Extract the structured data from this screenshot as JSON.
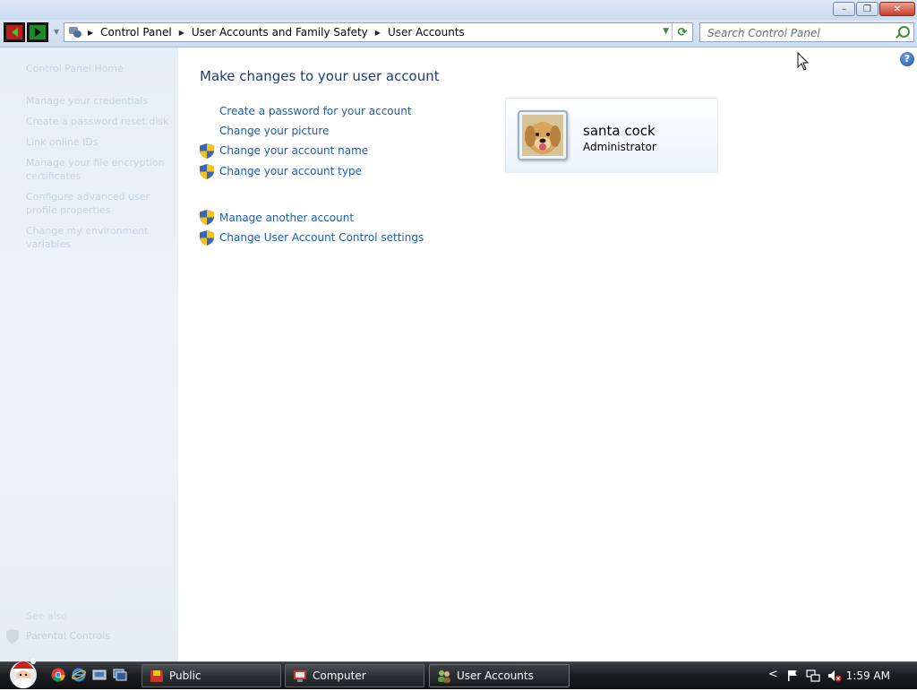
{
  "window": {
    "controls": {
      "minimize": "–",
      "maximize": "❐",
      "close": "✕"
    }
  },
  "nav": {
    "breadcrumbs": [
      "Control Panel",
      "User Accounts and Family Safety",
      "User Accounts"
    ],
    "search_placeholder": "Search Control Panel"
  },
  "left_pane": {
    "tasks": [
      "Control Panel Home",
      "Manage your credentials",
      "Create a password reset disk",
      "Link online IDs",
      "Manage your file encryption certificates",
      "Configure advanced user profile properties",
      "Change my environment variables"
    ],
    "see_also_heading": "See also",
    "see_also_items": [
      "Parental Controls"
    ]
  },
  "main": {
    "heading": "Make changes to your user account",
    "links_group1": [
      {
        "label": "Create a password for your account",
        "shield": false
      },
      {
        "label": "Change your picture",
        "shield": false
      },
      {
        "label": "Change your account name",
        "shield": true
      },
      {
        "label": "Change your account type",
        "shield": true
      }
    ],
    "links_group2": [
      {
        "label": "Manage another account",
        "shield": true
      },
      {
        "label": "Change User Account Control settings",
        "shield": true
      }
    ],
    "user": {
      "name": "santa cock",
      "role": "Administrator",
      "picture": "dog-avatar"
    },
    "help_glyph": "?"
  },
  "taskbar": {
    "buttons": [
      {
        "label": "Public",
        "icon": "folder-icon",
        "active": false
      },
      {
        "label": "Computer",
        "icon": "computer-icon",
        "active": false
      },
      {
        "label": "User Accounts",
        "icon": "users-icon",
        "active": true
      }
    ],
    "quick_launch": [
      "chrome-icon",
      "internet-explorer-icon",
      "show-desktop-icon",
      "switch-windows-icon"
    ],
    "tray_expand": "<",
    "clock": "1:59 AM"
  },
  "colors": {
    "link": "#1a5eb0",
    "heading": "#1e3a79",
    "nav_back": "#b91f1f",
    "nav_forward": "#1e8a2c",
    "close_button": "#c7402a"
  }
}
